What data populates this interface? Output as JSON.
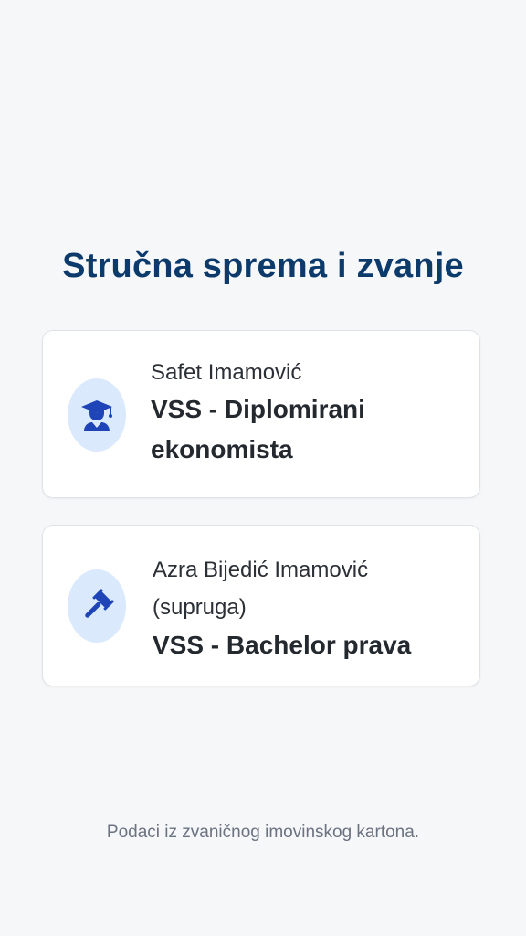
{
  "page": {
    "title": "Stručna sprema i zvanje",
    "footer": "Podaci iz zvaničnog imovinskog kartona."
  },
  "entries": [
    {
      "name": "Safet Imamović",
      "degree": "VSS - Diplomirani ekonomista",
      "icon": "graduate-icon"
    },
    {
      "name": "Azra Bijedić Imamović (supruga)",
      "degree": "VSS - Bachelor prava",
      "icon": "gavel-icon"
    }
  ],
  "colors": {
    "background": "#f6f7f9",
    "title": "#0b3a6b",
    "icon_bg": "#dbe9fc",
    "icon": "#1f44b8",
    "footer": "#6b7280"
  }
}
